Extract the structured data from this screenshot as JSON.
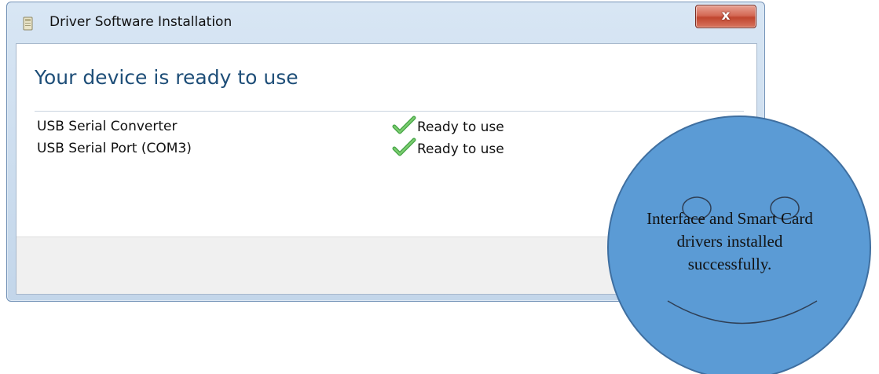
{
  "window": {
    "title": "Driver Software Installation",
    "close_label": "x"
  },
  "content": {
    "heading": "Your device is ready to use",
    "devices": [
      {
        "name": "USB Serial Converter",
        "status": "Ready to use"
      },
      {
        "name": "USB Serial Port (COM3)",
        "status": "Ready to use"
      }
    ]
  },
  "callout": {
    "text": "Interface and Smart Card drivers installed successfully."
  },
  "colors": {
    "heading": "#1e4e78",
    "close_button": "#c0462f",
    "callout_fill": "#5b9bd5",
    "callout_stroke": "#3f6fa0",
    "check": "#4aa84a"
  },
  "icons": {
    "title": "installer-icon",
    "status": "check-icon",
    "close": "close-icon"
  }
}
